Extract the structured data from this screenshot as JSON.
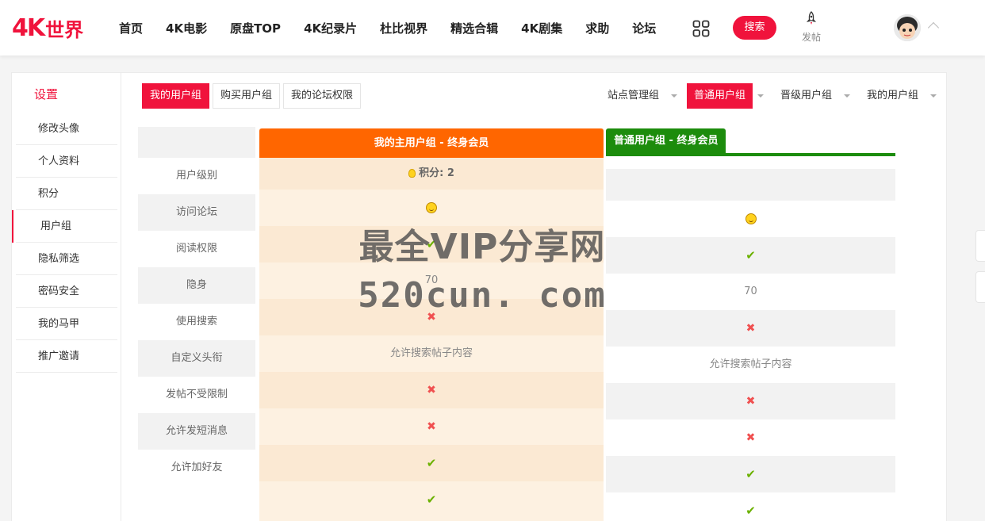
{
  "header": {
    "logo_4k": "4K",
    "logo_cn": "世界",
    "nav": [
      "首页",
      "4K电影",
      "原盘TOP",
      "4K纪录片",
      "杜比视界",
      "精选合辑",
      "4K剧集",
      "求助",
      "论坛"
    ],
    "search_label": "搜索",
    "post_label": "发帖"
  },
  "sidebar": {
    "title": "设置",
    "items": [
      "修改头像",
      "个人资料",
      "积分",
      "用户组",
      "隐私筛选",
      "密码安全",
      "我的马甲",
      "推广邀请"
    ],
    "active_index": 3
  },
  "tabs": [
    {
      "label": "我的用户组",
      "active": true
    },
    {
      "label": "购买用户组",
      "active": false
    },
    {
      "label": "我的论坛权限",
      "active": false
    }
  ],
  "group_menu": [
    {
      "label": "站点管理组",
      "active": false
    },
    {
      "label": "普通用户组",
      "active": true
    },
    {
      "label": "晋级用户组",
      "active": false
    },
    {
      "label": "我的用户组",
      "active": false
    }
  ],
  "table": {
    "row_labels": [
      "用户级别",
      "访问论坛",
      "阅读权限",
      "隐身",
      "使用搜索",
      "自定义头衔",
      "发帖不受限制",
      "允许发短消息",
      "允许加好友"
    ],
    "main_column": {
      "header": "我的主用户组 - 终身会员",
      "score_label": "积分: 2",
      "values": [
        "smile",
        "ok",
        "70",
        "no",
        "允许搜索帖子内容",
        "no",
        "no",
        "ok",
        "ok"
      ]
    },
    "second_column": {
      "header": "普通用户组 - 终身会员",
      "values": [
        "smile",
        "ok",
        "70",
        "no",
        "允许搜索帖子内容",
        "no",
        "no",
        "ok",
        "ok"
      ]
    }
  },
  "watermark": {
    "line1": "最全VIP分享网",
    "line2": "520cun. com"
  },
  "colors": {
    "brand": "#f0133c",
    "main_header": "#ff6600",
    "second_header": "#1c8c0c"
  }
}
